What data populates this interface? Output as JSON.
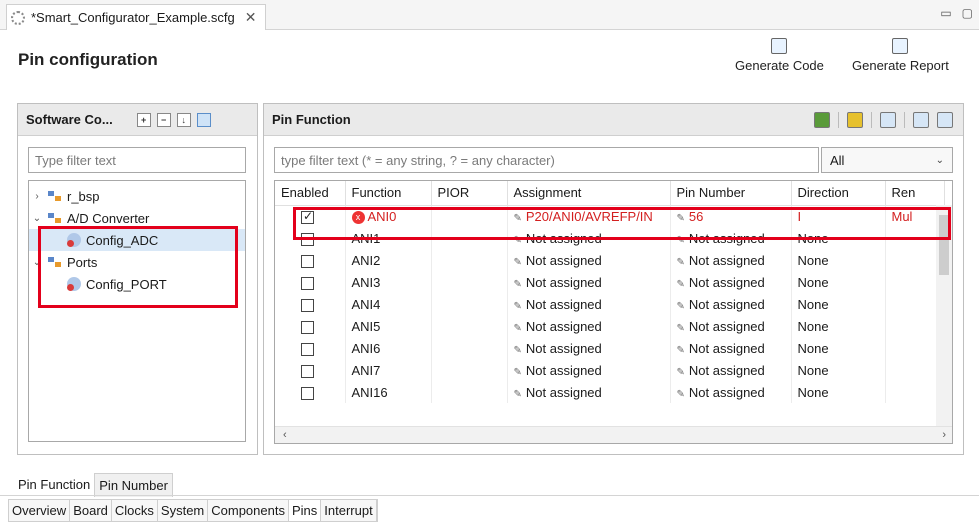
{
  "editor": {
    "tab_title": "*Smart_Configurator_Example.scfg",
    "close": "✕"
  },
  "window": {
    "minimize": "▭",
    "maximize": "▢"
  },
  "header": {
    "title": "Pin configuration",
    "generate_code": "Generate Code",
    "generate_report": "Generate Report"
  },
  "left_panel": {
    "title": "Software Co...",
    "filter_placeholder": "Type filter text",
    "tree": [
      {
        "label": "r_bsp",
        "chevron": "›"
      },
      {
        "label": "A/D Converter",
        "chevron": "⌄"
      },
      {
        "label": "Config_ADC"
      },
      {
        "label": "Ports",
        "chevron": "⌄"
      },
      {
        "label": "Config_PORT"
      }
    ]
  },
  "pin_panel": {
    "title": "Pin Function",
    "filter_placeholder": "type filter text (* = any string, ? = any character)",
    "select_value": "All",
    "columns": [
      "Enabled",
      "Function",
      "PIOR",
      "Assignment",
      "Pin Number",
      "Direction",
      "Ren"
    ],
    "rows": [
      {
        "enabled": true,
        "function": "ANI0",
        "pior": "",
        "assignment": "P20/ANI0/AVREFP/IN",
        "pin": "56",
        "direction": "I",
        "ren": "Mul",
        "error": true
      },
      {
        "enabled": false,
        "function": "ANI1",
        "pior": "",
        "assignment": "Not assigned",
        "pin": "Not assigned",
        "direction": "None",
        "ren": ""
      },
      {
        "enabled": false,
        "function": "ANI2",
        "pior": "",
        "assignment": "Not assigned",
        "pin": "Not assigned",
        "direction": "None",
        "ren": ""
      },
      {
        "enabled": false,
        "function": "ANI3",
        "pior": "",
        "assignment": "Not assigned",
        "pin": "Not assigned",
        "direction": "None",
        "ren": ""
      },
      {
        "enabled": false,
        "function": "ANI4",
        "pior": "",
        "assignment": "Not assigned",
        "pin": "Not assigned",
        "direction": "None",
        "ren": ""
      },
      {
        "enabled": false,
        "function": "ANI5",
        "pior": "",
        "assignment": "Not assigned",
        "pin": "Not assigned",
        "direction": "None",
        "ren": ""
      },
      {
        "enabled": false,
        "function": "ANI6",
        "pior": "",
        "assignment": "Not assigned",
        "pin": "Not assigned",
        "direction": "None",
        "ren": ""
      },
      {
        "enabled": false,
        "function": "ANI7",
        "pior": "",
        "assignment": "Not assigned",
        "pin": "Not assigned",
        "direction": "None",
        "ren": ""
      },
      {
        "enabled": false,
        "function": "ANI16",
        "pior": "",
        "assignment": "Not assigned",
        "pin": "Not assigned",
        "direction": "None",
        "ren": ""
      }
    ]
  },
  "view_tabs": [
    "Pin Function",
    "Pin Number"
  ],
  "editor_tabs": [
    "Overview",
    "Board",
    "Clocks",
    "System",
    "Components",
    "Pins",
    "Interrupt"
  ],
  "colors": {
    "error_red": "#d32020",
    "highlight": "#e3001b"
  }
}
